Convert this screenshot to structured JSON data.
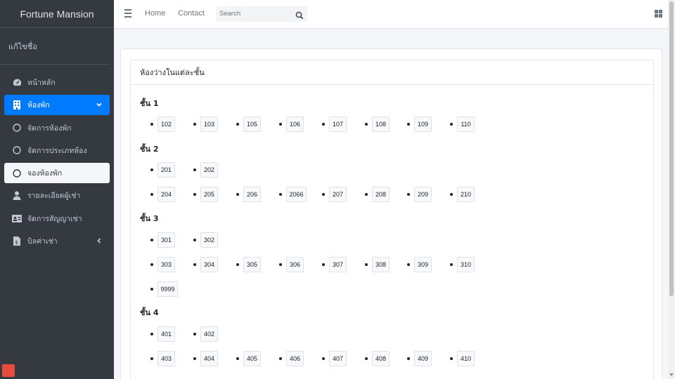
{
  "brand": {
    "title": "Fortune Mansion"
  },
  "user_panel": {
    "name": "แก้ไขชื่อ"
  },
  "sidebar": {
    "items": [
      {
        "label": "หน้าหลัก",
        "icon": "dashboard-icon"
      },
      {
        "label": "ห้องพัก",
        "icon": "building-icon",
        "state": "active"
      },
      {
        "label": "จัดการห้องพัก",
        "icon": "circle-icon"
      },
      {
        "label": "จัดการประเภทห้อง",
        "icon": "circle-icon"
      },
      {
        "label": "จองห้องพัก",
        "icon": "circle-icon",
        "state": "selected"
      },
      {
        "label": "รายละเอียดผู้เช่า",
        "icon": "user-icon"
      },
      {
        "label": "จัดการสัญญาเช่า",
        "icon": "id-card-icon"
      },
      {
        "label": "บิลค่าเช่า",
        "icon": "invoice-icon"
      }
    ]
  },
  "topbar": {
    "home": "Home",
    "contact": "Contact",
    "search_placeholder": "Search"
  },
  "card": {
    "title": "ห้องว่างในแต่ละชั้น"
  },
  "floors": [
    {
      "title": "ชั้น 1",
      "rows": [
        [
          "102",
          "103",
          "105",
          "106",
          "107",
          "108",
          "109",
          "110"
        ]
      ]
    },
    {
      "title": "ชั้น 2",
      "rows": [
        [
          "201",
          "202"
        ],
        [
          "204",
          "205",
          "206",
          "2066",
          "207",
          "208",
          "209",
          "210"
        ]
      ]
    },
    {
      "title": "ชั้น 3",
      "rows": [
        [
          "301",
          "302"
        ],
        [
          "303",
          "304",
          "305",
          "306",
          "307",
          "308",
          "309",
          "310"
        ],
        [
          "9999"
        ]
      ]
    },
    {
      "title": "ชั้น 4",
      "rows": [
        [
          "401",
          "402"
        ],
        [
          "403",
          "404",
          "405",
          "406",
          "407",
          "408",
          "409",
          "410"
        ]
      ]
    }
  ],
  "colors": {
    "sidebar": "#343a40",
    "accent": "#007bff",
    "background": "#f4f6f9"
  }
}
